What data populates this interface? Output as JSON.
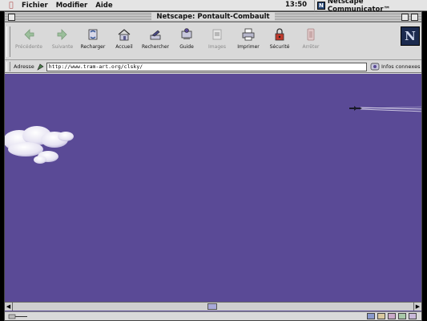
{
  "menubar": {
    "apple_icon": "apple-icon",
    "items": [
      "Fichier",
      "Modifier",
      "Aide"
    ],
    "clock": "13:50",
    "app_name": "Netscape Communicator™"
  },
  "window": {
    "title": "Netscape: Pontault-Combault"
  },
  "toolbar": {
    "buttons": [
      {
        "label": "Précédente",
        "icon": "back-arrow-icon",
        "enabled": false
      },
      {
        "label": "Suivante",
        "icon": "forward-arrow-icon",
        "enabled": false
      },
      {
        "label": "Recharger",
        "icon": "reload-icon",
        "enabled": true
      },
      {
        "label": "Accueil",
        "icon": "home-icon",
        "enabled": true
      },
      {
        "label": "Rechercher",
        "icon": "search-icon",
        "enabled": true
      },
      {
        "label": "Guide",
        "icon": "guide-icon",
        "enabled": true
      },
      {
        "label": "Images",
        "icon": "images-icon",
        "enabled": false
      },
      {
        "label": "Imprimer",
        "icon": "print-icon",
        "enabled": true
      },
      {
        "label": "Sécurité",
        "icon": "security-lock-icon",
        "enabled": true
      },
      {
        "label": "Arrêter",
        "icon": "stop-icon",
        "enabled": false
      }
    ],
    "logo_letter": "N"
  },
  "locbar": {
    "label": "Adresse",
    "url": "http://www.tram-art.org/clsky/",
    "related_label": "Infos connexes"
  },
  "content": {
    "background": "#5a4a96"
  }
}
